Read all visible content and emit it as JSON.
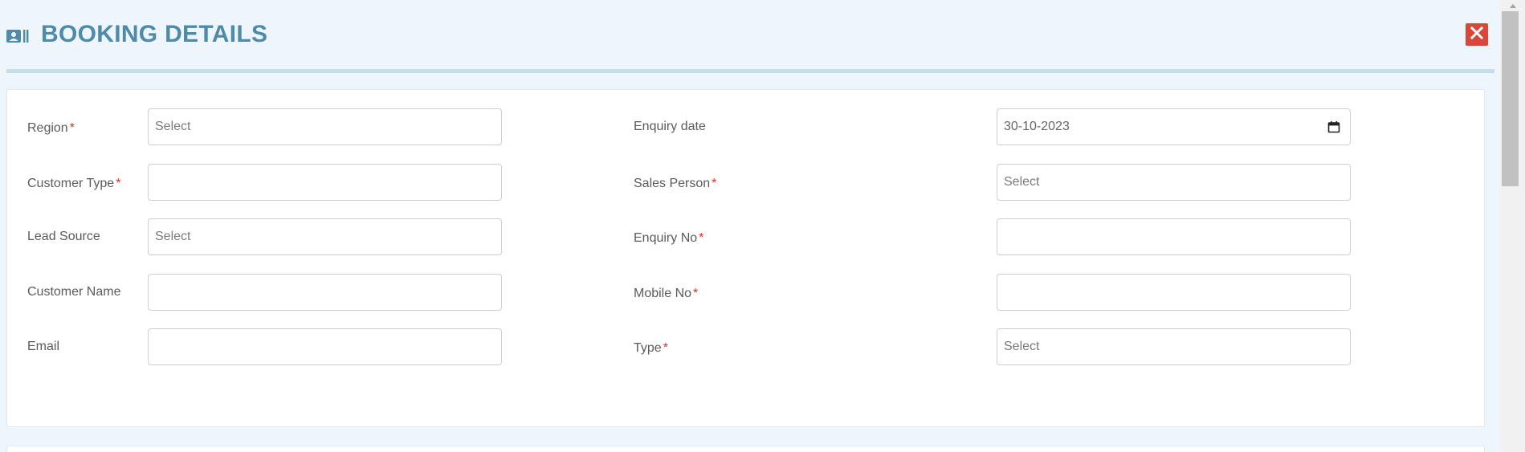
{
  "header": {
    "title": "BOOKING DETAILS",
    "title_icon": "contact-card-icon",
    "close_icon": "close-icon"
  },
  "form": {
    "left": [
      {
        "label": "Region",
        "required": "*",
        "value": "",
        "placeholder": "Select"
      },
      {
        "label": "Customer Type",
        "required": "*",
        "value": "",
        "placeholder": ""
      },
      {
        "label": "Lead Source",
        "required": "",
        "value": "",
        "placeholder": "Select"
      },
      {
        "label": "Customer Name",
        "required": "",
        "value": "",
        "placeholder": ""
      },
      {
        "label": "Email",
        "required": "",
        "value": "",
        "placeholder": ""
      }
    ],
    "right": [
      {
        "label": "Enquiry date",
        "required": "",
        "value": "30-10-2023",
        "placeholder": ""
      },
      {
        "label": "Sales Person",
        "required": "*",
        "value": "",
        "placeholder": "Select"
      },
      {
        "label": "Enquiry No",
        "required": "*",
        "value": "",
        "placeholder": ""
      },
      {
        "label": "Mobile No",
        "required": "*",
        "value": "",
        "placeholder": ""
      },
      {
        "label": "Type",
        "required": "*",
        "value": "",
        "placeholder": "Select"
      }
    ]
  },
  "colors": {
    "title": "#4f8aa8",
    "close_button": "#d9463a",
    "required_marker": "#d9302c",
    "header_rule": "#c4dfe8",
    "background": "#eef6fb"
  }
}
